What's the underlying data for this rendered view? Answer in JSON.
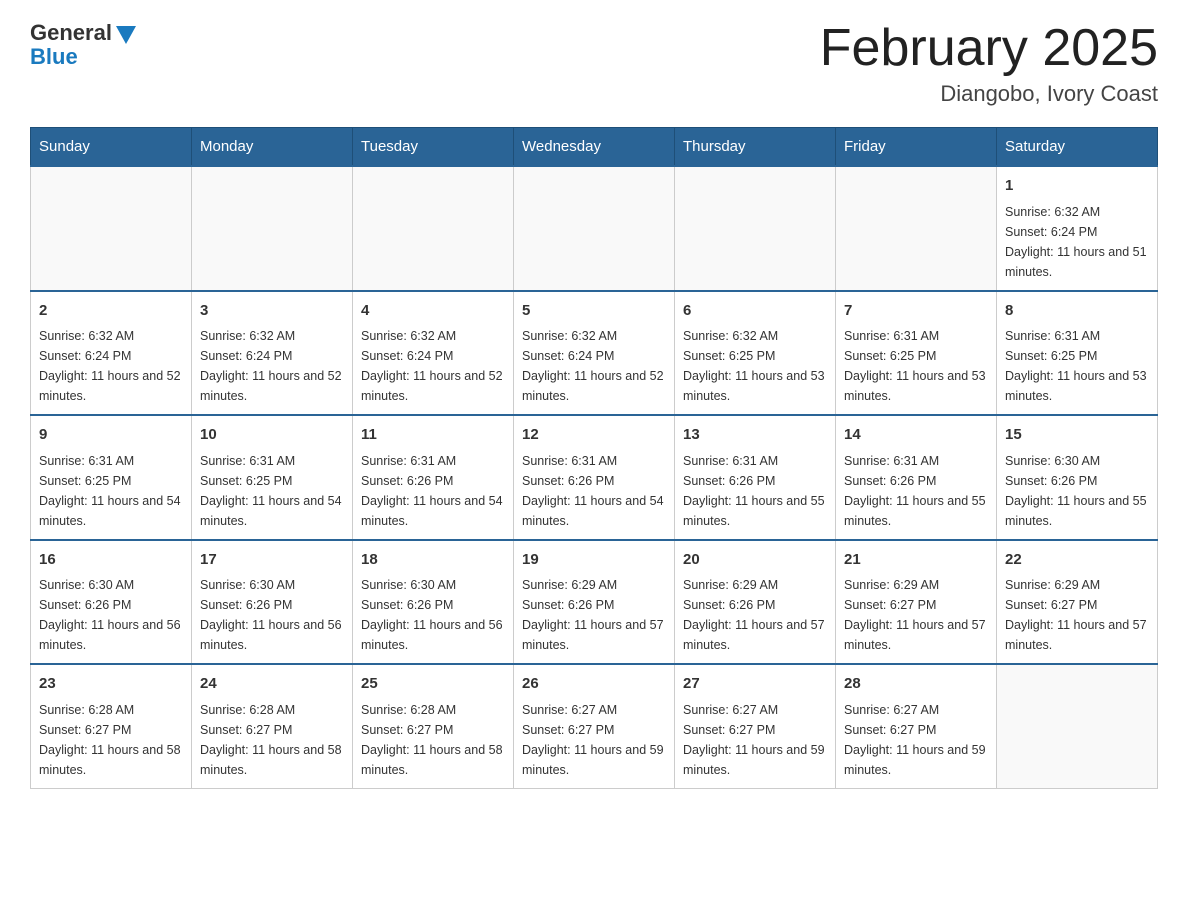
{
  "logo": {
    "general": "General",
    "blue": "Blue"
  },
  "header": {
    "title": "February 2025",
    "location": "Diangobo, Ivory Coast"
  },
  "days_of_week": [
    "Sunday",
    "Monday",
    "Tuesday",
    "Wednesday",
    "Thursday",
    "Friday",
    "Saturday"
  ],
  "weeks": [
    [
      {
        "day": "",
        "info": ""
      },
      {
        "day": "",
        "info": ""
      },
      {
        "day": "",
        "info": ""
      },
      {
        "day": "",
        "info": ""
      },
      {
        "day": "",
        "info": ""
      },
      {
        "day": "",
        "info": ""
      },
      {
        "day": "1",
        "info": "Sunrise: 6:32 AM\nSunset: 6:24 PM\nDaylight: 11 hours and 51 minutes."
      }
    ],
    [
      {
        "day": "2",
        "info": "Sunrise: 6:32 AM\nSunset: 6:24 PM\nDaylight: 11 hours and 52 minutes."
      },
      {
        "day": "3",
        "info": "Sunrise: 6:32 AM\nSunset: 6:24 PM\nDaylight: 11 hours and 52 minutes."
      },
      {
        "day": "4",
        "info": "Sunrise: 6:32 AM\nSunset: 6:24 PM\nDaylight: 11 hours and 52 minutes."
      },
      {
        "day": "5",
        "info": "Sunrise: 6:32 AM\nSunset: 6:24 PM\nDaylight: 11 hours and 52 minutes."
      },
      {
        "day": "6",
        "info": "Sunrise: 6:32 AM\nSunset: 6:25 PM\nDaylight: 11 hours and 53 minutes."
      },
      {
        "day": "7",
        "info": "Sunrise: 6:31 AM\nSunset: 6:25 PM\nDaylight: 11 hours and 53 minutes."
      },
      {
        "day": "8",
        "info": "Sunrise: 6:31 AM\nSunset: 6:25 PM\nDaylight: 11 hours and 53 minutes."
      }
    ],
    [
      {
        "day": "9",
        "info": "Sunrise: 6:31 AM\nSunset: 6:25 PM\nDaylight: 11 hours and 54 minutes."
      },
      {
        "day": "10",
        "info": "Sunrise: 6:31 AM\nSunset: 6:25 PM\nDaylight: 11 hours and 54 minutes."
      },
      {
        "day": "11",
        "info": "Sunrise: 6:31 AM\nSunset: 6:26 PM\nDaylight: 11 hours and 54 minutes."
      },
      {
        "day": "12",
        "info": "Sunrise: 6:31 AM\nSunset: 6:26 PM\nDaylight: 11 hours and 54 minutes."
      },
      {
        "day": "13",
        "info": "Sunrise: 6:31 AM\nSunset: 6:26 PM\nDaylight: 11 hours and 55 minutes."
      },
      {
        "day": "14",
        "info": "Sunrise: 6:31 AM\nSunset: 6:26 PM\nDaylight: 11 hours and 55 minutes."
      },
      {
        "day": "15",
        "info": "Sunrise: 6:30 AM\nSunset: 6:26 PM\nDaylight: 11 hours and 55 minutes."
      }
    ],
    [
      {
        "day": "16",
        "info": "Sunrise: 6:30 AM\nSunset: 6:26 PM\nDaylight: 11 hours and 56 minutes."
      },
      {
        "day": "17",
        "info": "Sunrise: 6:30 AM\nSunset: 6:26 PM\nDaylight: 11 hours and 56 minutes."
      },
      {
        "day": "18",
        "info": "Sunrise: 6:30 AM\nSunset: 6:26 PM\nDaylight: 11 hours and 56 minutes."
      },
      {
        "day": "19",
        "info": "Sunrise: 6:29 AM\nSunset: 6:26 PM\nDaylight: 11 hours and 57 minutes."
      },
      {
        "day": "20",
        "info": "Sunrise: 6:29 AM\nSunset: 6:26 PM\nDaylight: 11 hours and 57 minutes."
      },
      {
        "day": "21",
        "info": "Sunrise: 6:29 AM\nSunset: 6:27 PM\nDaylight: 11 hours and 57 minutes."
      },
      {
        "day": "22",
        "info": "Sunrise: 6:29 AM\nSunset: 6:27 PM\nDaylight: 11 hours and 57 minutes."
      }
    ],
    [
      {
        "day": "23",
        "info": "Sunrise: 6:28 AM\nSunset: 6:27 PM\nDaylight: 11 hours and 58 minutes."
      },
      {
        "day": "24",
        "info": "Sunrise: 6:28 AM\nSunset: 6:27 PM\nDaylight: 11 hours and 58 minutes."
      },
      {
        "day": "25",
        "info": "Sunrise: 6:28 AM\nSunset: 6:27 PM\nDaylight: 11 hours and 58 minutes."
      },
      {
        "day": "26",
        "info": "Sunrise: 6:27 AM\nSunset: 6:27 PM\nDaylight: 11 hours and 59 minutes."
      },
      {
        "day": "27",
        "info": "Sunrise: 6:27 AM\nSunset: 6:27 PM\nDaylight: 11 hours and 59 minutes."
      },
      {
        "day": "28",
        "info": "Sunrise: 6:27 AM\nSunset: 6:27 PM\nDaylight: 11 hours and 59 minutes."
      },
      {
        "day": "",
        "info": ""
      }
    ]
  ]
}
